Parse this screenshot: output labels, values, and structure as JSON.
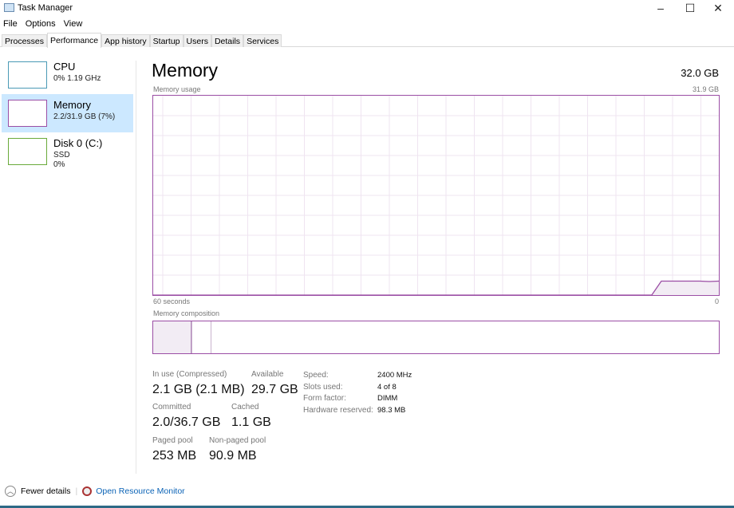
{
  "window": {
    "title": "Task Manager",
    "minimize": "–",
    "maximize": "☐",
    "close": "✕"
  },
  "menu": [
    "File",
    "Options",
    "View"
  ],
  "tabs": [
    "Processes",
    "Performance",
    "App history",
    "Startup",
    "Users",
    "Details",
    "Services"
  ],
  "active_tab": "Performance",
  "sidebar": [
    {
      "name": "CPU",
      "line1": "0% 1.19 GHz",
      "color": "#4a9ab5"
    },
    {
      "name": "Memory",
      "line1": "2.2/31.9 GB (7%)",
      "color": "#9b4ea5"
    },
    {
      "name": "Disk 0 (C:)",
      "line1": "SSD",
      "line2": "0%",
      "color": "#6aaa3a"
    }
  ],
  "main": {
    "title": "Memory",
    "total": "32.0 GB",
    "usage_label": "Memory usage",
    "usage_max": "31.9 GB",
    "time_left": "60 seconds",
    "time_right": "0",
    "composition_label": "Memory composition",
    "usage_history_percent": [
      0,
      0,
      0,
      0,
      0,
      0,
      0,
      0,
      0,
      0,
      0,
      0,
      0,
      0,
      0,
      0,
      0,
      0,
      0,
      0,
      0,
      0,
      0,
      0,
      0,
      0,
      0,
      0,
      0,
      0,
      0,
      0,
      0,
      0,
      0,
      0,
      0,
      0,
      0,
      0,
      0,
      0,
      0,
      0,
      0,
      0,
      0,
      0,
      0,
      0,
      0,
      0,
      0,
      7,
      7,
      7,
      7,
      7,
      6.8,
      7
    ],
    "composition_percent": {
      "in_use": 6.7,
      "modified": 0.2,
      "standby": 3.4,
      "free": 89.7
    },
    "stats": {
      "in_use_label": "In use (Compressed)",
      "in_use": "2.1 GB (2.1 MB)",
      "available_label": "Available",
      "available": "29.7 GB",
      "committed_label": "Committed",
      "committed": "2.0/36.7 GB",
      "cached_label": "Cached",
      "cached": "1.1 GB",
      "paged_label": "Paged pool",
      "paged": "253 MB",
      "nonpaged_label": "Non-paged pool",
      "nonpaged": "90.9 MB"
    },
    "details": [
      {
        "k": "Speed:",
        "v": "2400 MHz"
      },
      {
        "k": "Slots used:",
        "v": "4 of 8"
      },
      {
        "k": "Form factor:",
        "v": "DIMM"
      },
      {
        "k": "Hardware reserved:",
        "v": "98.3 MB"
      }
    ]
  },
  "footer": {
    "fewer": "Fewer details",
    "monitor": "Open Resource Monitor"
  }
}
